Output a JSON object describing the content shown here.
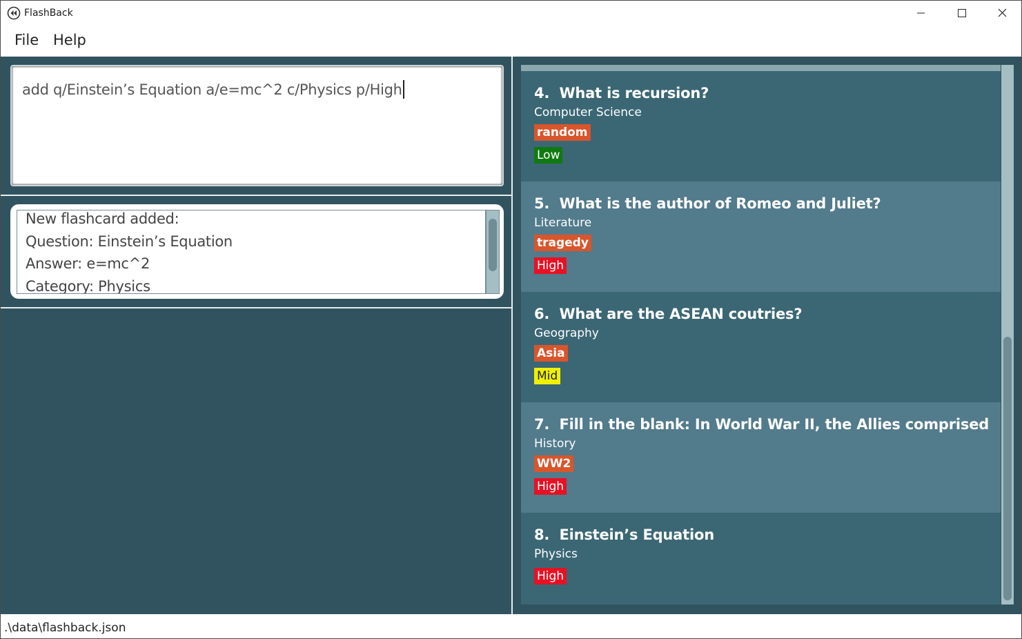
{
  "window": {
    "title": "FlashBack",
    "icon": "flashback-logo-icon"
  },
  "menu": {
    "file": "File",
    "help": "Help"
  },
  "command": {
    "text": "add q/Einstein’s Equation a/e=mc^2 c/Physics p/High"
  },
  "result": {
    "lines": [
      "New flashcard added:",
      "Question: Einstein’s Equation",
      "Answer: e=mc^2",
      "Category: Physics"
    ]
  },
  "cards": [
    {
      "index": "4.",
      "question": "What is recursion?",
      "category": "Computer Science",
      "tag": "random",
      "priority": "Low"
    },
    {
      "index": "5.",
      "question": "What is the author of Romeo and Juliet?",
      "category": "Literature",
      "tag": "tragedy",
      "priority": "High"
    },
    {
      "index": "6.",
      "question": "What are the ASEAN coutries?",
      "category": "Geography",
      "tag": "Asia",
      "priority": "Mid"
    },
    {
      "index": "7.",
      "question": "Fill in the blank: In World War II, the Allies comprised of France, ...",
      "category": "History",
      "tag": "WW2",
      "priority": "High"
    },
    {
      "index": "8.",
      "question": "Einstein’s Equation",
      "category": "Physics",
      "tag": "",
      "priority": "High"
    }
  ],
  "colors": {
    "tag": "#d9552b",
    "priority_low": "#107a10",
    "priority_mid": "#f0f000",
    "priority_high": "#e81123",
    "pane_bg": "#31535f",
    "card_dark": "#3b6775",
    "card_light": "#527b8c"
  },
  "status": {
    "path": ".\\data\\flashback.json"
  }
}
